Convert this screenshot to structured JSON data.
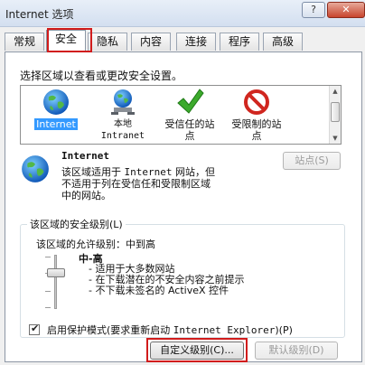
{
  "window": {
    "title": "Internet 选项",
    "help": "?",
    "close": "✕"
  },
  "tabs": [
    {
      "label": "常规"
    },
    {
      "label": "安全"
    },
    {
      "label": "隐私"
    },
    {
      "label": "内容"
    },
    {
      "label": "连接"
    },
    {
      "label": "程序"
    },
    {
      "label": "高级"
    }
  ],
  "zones": {
    "prompt": "选择区域以查看或更改安全设置。",
    "items": [
      {
        "label": "Internet",
        "icon": "globe-icon"
      },
      {
        "label": "本地\nIntranet",
        "icon": "intranet-icon"
      },
      {
        "label": "受信任的站\n点",
        "icon": "checkmark-icon"
      },
      {
        "label": "受限制的站\n点",
        "icon": "restricted-icon"
      }
    ]
  },
  "selected_zone": {
    "name": "Internet",
    "desc_line1_a": "该区域适用于 ",
    "desc_line1_b": "Internet",
    "desc_line1_c": " 网站，但",
    "desc_line2": "不适用于列在受信任和受限制区域",
    "desc_line3": "中的网站。",
    "sites_button": "站点(S)"
  },
  "security_level": {
    "group_title": "该区域的安全级别(L)",
    "allowed": "该区域的允许级别：中到高",
    "level": "中-高",
    "bullets": [
      "- 适用于大多数网站",
      "- 在下载潜在的不安全内容之前提示",
      "- 不下载未签名的 ActiveX 控件"
    ],
    "protected_mode_a": "启用保护模式(要求重新启动 ",
    "protected_mode_b": "Internet Explorer",
    "protected_mode_c": ")(P)",
    "protected_checked": true,
    "custom_button": "自定义级别(C)...",
    "default_button": "默认级别(D)"
  },
  "colors": {
    "highlight": "#d11c1c",
    "selection": "#3399ff"
  }
}
